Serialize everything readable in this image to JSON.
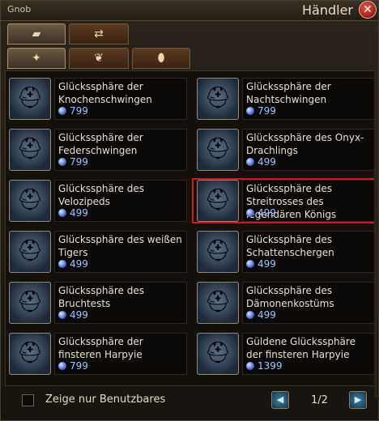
{
  "window": {
    "npc": "Gnob",
    "title": "Händler",
    "close_icon": "close-icon"
  },
  "tabs_top": [
    {
      "icon": "gold-icon",
      "glyph": "▰"
    },
    {
      "icon": "swap-arrows-icon",
      "glyph": "⇄"
    }
  ],
  "tabs_sub": [
    {
      "icon": "mount-icon",
      "glyph": "✦"
    },
    {
      "icon": "pet-icon",
      "glyph": "❦"
    },
    {
      "icon": "acorn-icon",
      "glyph": "⬮"
    }
  ],
  "currency_icon": "gem-orb-icon",
  "items": [
    {
      "name": "Glückssphäre der Knochenschwingen",
      "price": "799",
      "glyph": "⛑"
    },
    {
      "name": "Glückssphäre der Nachtschwingen",
      "price": "799",
      "glyph": "⛑"
    },
    {
      "name": "Glückssphäre der Federschwingen",
      "price": "799",
      "glyph": "⛑"
    },
    {
      "name": "Glückssphäre des Onyx-Drachlings",
      "price": "499",
      "glyph": "⛑"
    },
    {
      "name": "Glückssphäre des Velozipeds",
      "price": "499",
      "glyph": "⛑"
    },
    {
      "name": "Glückssphäre des Streitrosses des legendären Königs",
      "price": "499",
      "glyph": "⛑"
    },
    {
      "name": "Glückssphäre des weißen Tigers",
      "price": "499",
      "glyph": "⛑"
    },
    {
      "name": "Glückssphäre des Schattenschergen",
      "price": "499",
      "glyph": "⛑"
    },
    {
      "name": "Glückssphäre des Bruchtests",
      "price": "499",
      "glyph": "⛑"
    },
    {
      "name": "Glückssphäre des Dämonenkostüms",
      "price": "499",
      "glyph": "⛑"
    },
    {
      "name": "Glückssphäre der finsteren Harpyie",
      "price": "799",
      "glyph": "⛑"
    },
    {
      "name": "Güldene Glückssphäre der finsteren Harpyie",
      "price": "1399",
      "glyph": "⛑"
    }
  ],
  "footer": {
    "filter_label": "Zeige nur Benutzbares",
    "page": "1/2",
    "prev_icon": "page-prev-icon",
    "next_icon": "page-next-icon"
  },
  "colors": {
    "selection": "#d81414",
    "currency": "#9fc4ff",
    "accent": "#d9c6a0"
  }
}
